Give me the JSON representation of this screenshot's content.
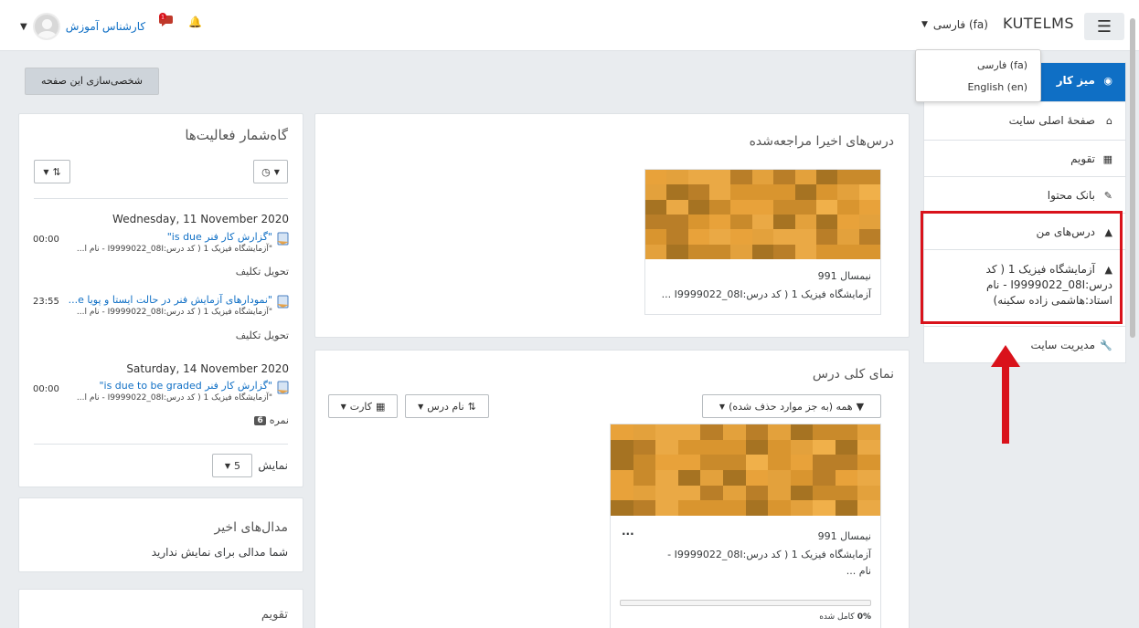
{
  "header": {
    "brand": "KUTELMS",
    "language_toggle": "فارسی (fa)",
    "user_name": "کارشناس آموزش",
    "message_badge": "1"
  },
  "language_menu": {
    "options": [
      "فارسی (fa)",
      "English (en)"
    ]
  },
  "nav": {
    "items": [
      {
        "label": "میز کار",
        "icon": "tachometer-icon"
      },
      {
        "label": "صفحهٔ اصلی سایت",
        "icon": "home-icon"
      },
      {
        "label": "تقویم",
        "icon": "calendar-icon"
      },
      {
        "label": "بانک محتوا",
        "icon": "paint-brush-icon"
      },
      {
        "label": "درس‌های من",
        "icon": "graduation-cap-icon"
      },
      {
        "label": "آزمایشگاه فیزیک 1 ( کد درس:I9999022_08I - نام استاد:هاشمی زاده سکینه)",
        "icon": "graduation-cap-icon"
      },
      {
        "label": "مدیریت سایت",
        "icon": "wrench-icon"
      }
    ],
    "course_lines": [
      "آزمایشگاه فیزیک 1 ( کد",
      "درس:I9999022_08I - نام",
      "استاد:هاشمی زاده سکینه)"
    ]
  },
  "customize_button": "شخصی‌سازی این صفحه",
  "timeline": {
    "title": "گاه‌شمار فعالیت‌ها",
    "groups": [
      {
        "date": "Wednesday, 11 November 2020",
        "events": [
          {
            "time": "00:00",
            "title": "\"گزارش کار فنر is due\"",
            "course": "\"آزمایشگاه فیزیک 1 ( کد درس:I9999022_08I - نام ا...",
            "action": "تحویل تکلیف"
          },
          {
            "time": "23:55",
            "title": "\"نمودارهای آزمایش فنر در حالت ایستا و پویا e...",
            "course": "\"آزمایشگاه فیزیک 1 ( کد درس:I9999022_08I - نام ا...",
            "action": "تحویل تکلیف"
          }
        ]
      },
      {
        "date": "Saturday, 14 November 2020",
        "events": [
          {
            "time": "00:00",
            "title": "\"گزارش کار فنر is due to be graded\"",
            "course": "\"آزمایشگاه فیزیک 1 ( کد درس:I9999022_08I - نام ا...",
            "action": "نمره",
            "badge": "6"
          }
        ]
      }
    ],
    "show_label": "نمایش",
    "show_value": "5"
  },
  "badges": {
    "title": "مدال‌های اخیر",
    "text": "شما مدالی برای نمایش ندارید"
  },
  "calendar": {
    "title": "تقویم"
  },
  "recent_courses": {
    "title": "درس‌های اخیرا مراجعه‌شده",
    "course": {
      "category": "نیمسال 991",
      "name": "آزمایشگاه فیزیک 1 ( کد درس:I9999022_08I ..."
    }
  },
  "overview": {
    "title": "نمای کلی درس",
    "filter": "همه (به جز موارد حذف شده)",
    "sort": "نام درس",
    "view": "کارت",
    "course": {
      "category": "نیمسال 991",
      "name_line1": "آزمایشگاه فیزیک 1 ( کد درس:I9999022_08I -",
      "name_line2": "نام ...",
      "more": "...",
      "progress_pct": "0%",
      "progress_label": "کامل شده",
      "progress": 0
    }
  },
  "colors": {
    "primary": "#0f6fc5",
    "highlight": "#d9121b",
    "thumb_base": "#e8a23a"
  }
}
